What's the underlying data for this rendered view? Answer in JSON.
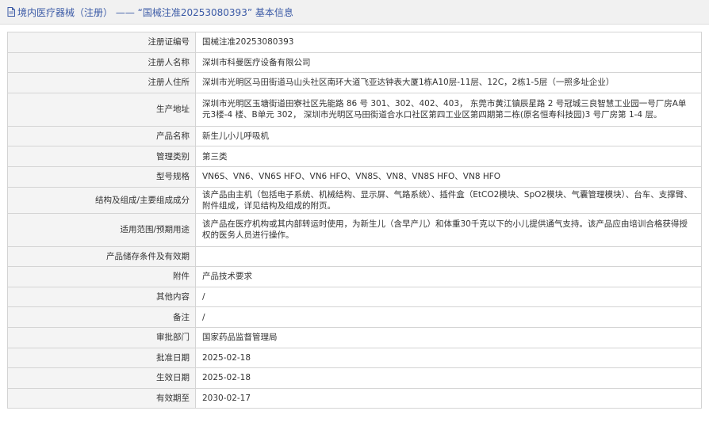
{
  "header": {
    "title": "境内医疗器械（注册） —— “国械注准20253080393” 基本信息"
  },
  "rows": [
    {
      "label": "注册证编号",
      "value": "国械注准20253080393"
    },
    {
      "label": "注册人名称",
      "value": "深圳市科曼医疗设备有限公司"
    },
    {
      "label": "注册人住所",
      "value": "深圳市光明区马田街道马山头社区南环大道飞亚达钟表大厦1栋A10层-11层、12C，2栋1-5层（一照多址企业）"
    },
    {
      "label": "生产地址",
      "value": "深圳市光明区玉塘街道田寮社区先能路 86 号 301、302、402、403， 东莞市黄江镇辰星路 2 号冠城三良智慧工业园一号厂房A单元3楼-4 楼、B单元 302， 深圳市光明区马田街道合水口社区第四工业区第四期第二栋(原名恒寿科技园)3 号厂房第 1-4 层。"
    },
    {
      "label": "产品名称",
      "value": "新生儿小儿呼吸机"
    },
    {
      "label": "管理类别",
      "value": "第三类"
    },
    {
      "label": "型号规格",
      "value": "VN6S、VN6、VN6S HFO、VN6 HFO、VN8S、VN8、VN8S HFO、VN8 HFO"
    },
    {
      "label": "结构及组成/主要组成成分",
      "value": "该产品由主机（包括电子系统、机械结构、显示屏、气路系统）、插件盒（EtCO2模块、SpO2模块、气囊管理模块）、台车、支撑臂、附件组成，详见结构及组成的附页。"
    },
    {
      "label": "适用范围/预期用途",
      "value": "该产品在医疗机构或其内部转运时使用，为新生儿（含早产儿）和体重30千克以下的小儿提供通气支持。该产品应由培训合格获得授权的医务人员进行操作。"
    },
    {
      "label": "产品储存条件及有效期",
      "value": ""
    },
    {
      "label": "附件",
      "value": "产品技术要求"
    },
    {
      "label": "其他内容",
      "value": "/"
    },
    {
      "label": "备注",
      "value": "/"
    },
    {
      "label": "审批部门",
      "value": "国家药品监督管理局"
    },
    {
      "label": "批准日期",
      "value": "2025-02-18"
    },
    {
      "label": "生效日期",
      "value": "2025-02-18"
    },
    {
      "label": "有效期至",
      "value": "2030-02-17"
    }
  ],
  "colors": {
    "header_text": "#3b5aa6",
    "header_bg": "#f1f1f1",
    "label_bg": "#f4f4f4",
    "border": "#d4d4d4"
  },
  "icons": {
    "header": "document-icon"
  }
}
